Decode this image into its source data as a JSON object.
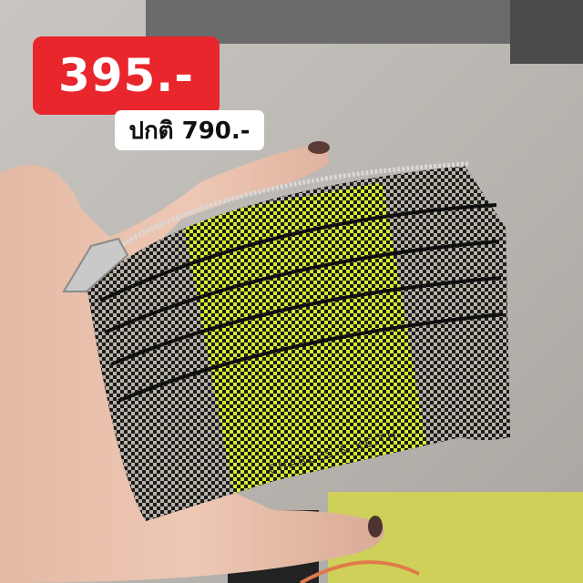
{
  "sale_price": "395.-",
  "regular_price_label": "ปกติ 790.-",
  "brand_stamp": "CHARLES & KEITH",
  "colors": {
    "price_badge": "#e8262c",
    "wallet_neon": "#d6ec2e",
    "wallet_grey": "#b9b3a8",
    "wallet_edge": "#121212"
  }
}
